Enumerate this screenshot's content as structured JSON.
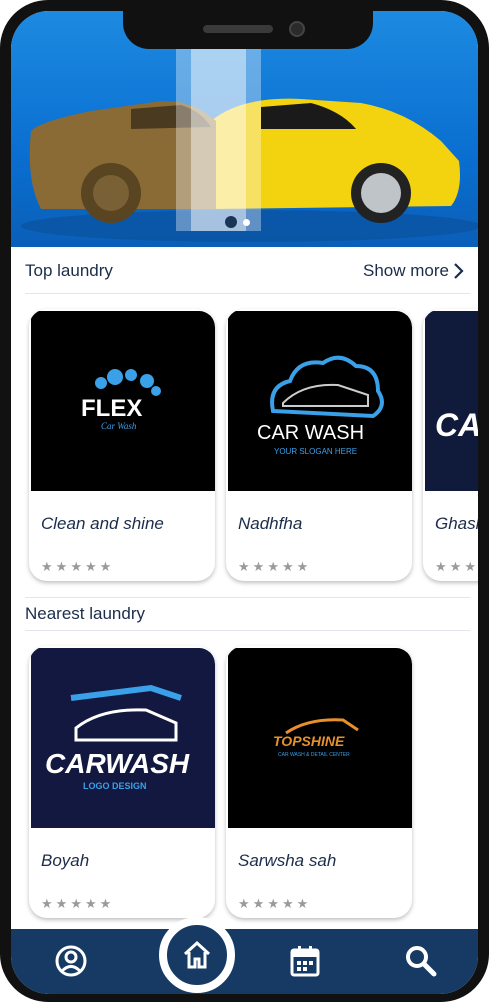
{
  "banner": {
    "active_slide": 1,
    "slide_count": 2
  },
  "top_section": {
    "title": "Top laundry",
    "more_label": "Show more",
    "cards": [
      {
        "name": "Clean and shine",
        "rating": 0,
        "logo_text": "FLEX",
        "logo_sub": "Car Wash"
      },
      {
        "name": "Nadhfha",
        "rating": 0,
        "logo_text": "CAR WASH",
        "logo_sub": "YOUR SLOGAN HERE"
      },
      {
        "name": "Ghash",
        "rating": 0,
        "logo_text": "CA"
      }
    ]
  },
  "nearest_section": {
    "title": "Nearest laundry",
    "cards": [
      {
        "name": "Boyah",
        "rating": 0,
        "logo_text": "CARWASH",
        "logo_sub": "LOGO DESIGN"
      },
      {
        "name": "Sarwsha sah",
        "rating": 0,
        "logo_text": "TOPSHINE",
        "logo_sub": "CAR WASH & DETAIL CENTER"
      }
    ]
  },
  "nav": {
    "items": [
      "profile-icon",
      "home-icon",
      "calendar-icon",
      "search-icon"
    ],
    "active": "home-icon"
  },
  "colors": {
    "primary": "#163a63",
    "banner": "#0a6fd1",
    "text": "#1b2d4a"
  }
}
